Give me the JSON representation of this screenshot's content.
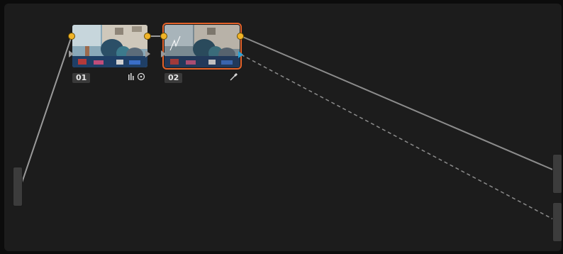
{
  "nodes": [
    {
      "label": "01",
      "icons": [
        "histogram-icon",
        "target-icon"
      ]
    },
    {
      "label": "02",
      "icons": [
        "eyedropper-icon"
      ]
    }
  ],
  "colors": {
    "canvas": "#1c1c1c",
    "selection": "#e3622a",
    "port": "#f1b428",
    "alpha_port": "#2aa3d8",
    "wire": "#8c8c8c"
  }
}
